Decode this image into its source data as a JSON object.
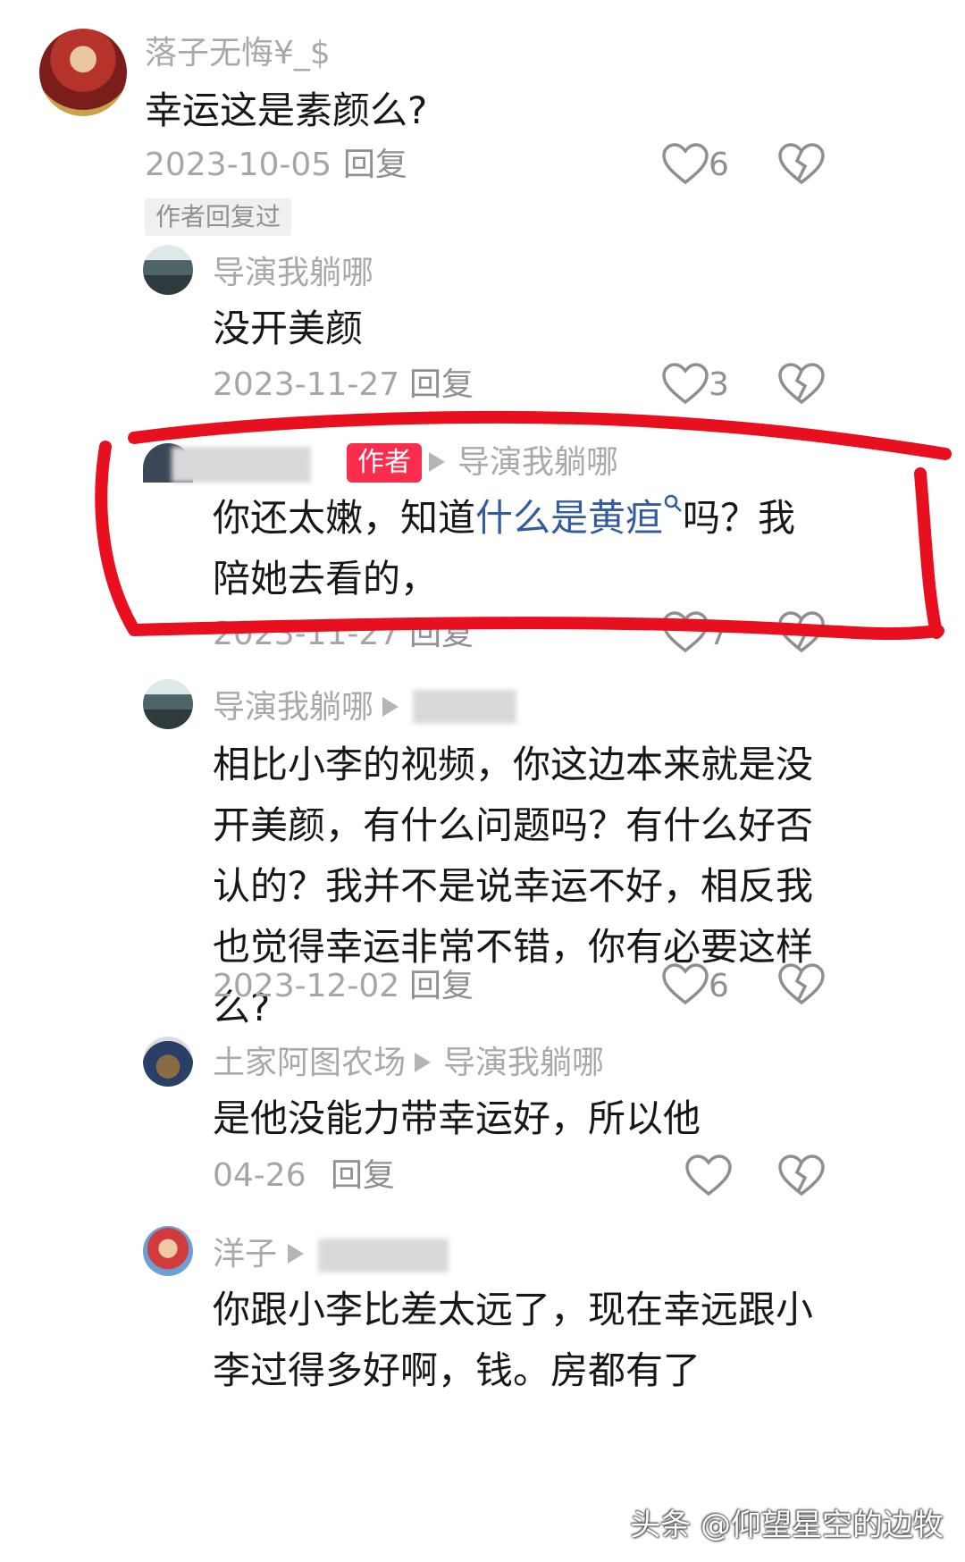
{
  "comments": [
    {
      "user": "落子无悔¥_$",
      "text": "幸运这是素颜么?",
      "date": "2023-10-05",
      "reply_label": "回复",
      "likes": "6",
      "tag": "作者回复过"
    },
    {
      "user": "导演我躺哪",
      "text": "没开美颜",
      "date": "2023-11-27",
      "reply_label": "回复",
      "likes": "3"
    },
    {
      "author_badge": "作者",
      "reply_to": "导演我躺哪",
      "text_before": "你还太嫩，知道",
      "link_text": "什么是黄疸",
      "text_after": "吗？我陪她去看的，",
      "date": "2023-11-27",
      "reply_label": "回复",
      "likes": "7"
    },
    {
      "user": "导演我躺哪",
      "text": "相比小李的视频，你这边本来就是没开美颜，有什么问题吗？有什么好否认的？我并不是说幸运不好，相反我也觉得幸运非常不错，你有必要这样么?",
      "date": "2023-12-02",
      "reply_label": "回复",
      "likes": "6"
    },
    {
      "user": "土家阿图农场",
      "reply_to": "导演我躺哪",
      "text": "是他没能力带幸运好，所以他",
      "date": "04-26",
      "reply_label": "回复"
    },
    {
      "user": "洋子",
      "text": "你跟小李比差太远了，现在幸远跟小李过得多好啊，钱。房都有了",
      "date": "",
      "reply_label": ""
    }
  ],
  "watermark": "头条 @仰望星空的边牧",
  "colors": {
    "highlight": "#e8101e",
    "link": "#325c9f",
    "badge": "#fb2d4f",
    "meta": "#a6a6aa"
  }
}
